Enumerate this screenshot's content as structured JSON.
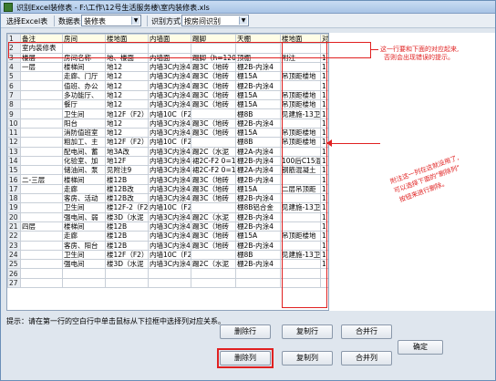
{
  "window": {
    "title": "识别Excel装修表 - F:\\工作\\12号生活服务楼\\室内装修表.xls"
  },
  "toolbar": {
    "select_sheet_label": "选择Excel表",
    "data_table_label": "数据表:",
    "data_table_value": "装修表",
    "identify_method_label": "识别方式:",
    "identify_method_value": "按房间识别"
  },
  "grid": {
    "rows": [
      {
        "n": "1",
        "cells": [
          "备注",
          "房间",
          "楼地面",
          "内墙面",
          "踢脚",
          "天棚",
          "楼地面",
          "对应楼层"
        ]
      },
      {
        "n": "2",
        "cells": [
          "室内装修表",
          "",
          "",
          "",
          "",
          "",
          "",
          ""
        ]
      },
      {
        "n": "3",
        "cells": [
          "楼层",
          "房间名称",
          "地、楼面",
          "内墙面",
          "踢脚（h=120",
          "顶棚",
          "附注",
          "1"
        ]
      },
      {
        "n": "4",
        "cells": [
          "一层",
          "楼梯间",
          "地12",
          "内墙3C内涂4",
          "踢3C（地砖",
          "棚2B-内涂4",
          "",
          "1"
        ]
      },
      {
        "n": "5",
        "cells": [
          "",
          "走廊、门厅",
          "地12",
          "内墙3C内涂4",
          "踢3C（地砖",
          "棚15A",
          "吊顶距楼地",
          "1"
        ]
      },
      {
        "n": "6",
        "cells": [
          "",
          "值班、办公",
          "地12",
          "内墙3C内涂4",
          "踢3C（地砖",
          "棚2B-内涂4",
          "",
          "1"
        ]
      },
      {
        "n": "7",
        "cells": [
          "",
          "多功能厅、",
          "地12",
          "内墙3C内涂4",
          "踢3C（地砖",
          "棚15A",
          "吊顶距楼地",
          "1"
        ]
      },
      {
        "n": "8",
        "cells": [
          "",
          "餐厅",
          "地12",
          "内墙3C内涂4",
          "踢3C（地砖",
          "棚15A",
          "吊顶距楼地",
          "1"
        ]
      },
      {
        "n": "9",
        "cells": [
          "",
          "卫生间",
          "地12F（F2）",
          "内墙10C（F2",
          "",
          "棚8B",
          "见建施-13卫",
          "1"
        ]
      },
      {
        "n": "10",
        "cells": [
          "",
          "阳台",
          "地12",
          "内墙3C内涂4",
          "踢3C（地砖",
          "棚2B-内涂4",
          "",
          "1"
        ]
      },
      {
        "n": "11",
        "cells": [
          "",
          "消防值班室",
          "地12",
          "内墙3C内涂4",
          "踢3C（地砖",
          "棚15A",
          "吊顶距楼地",
          "1"
        ]
      },
      {
        "n": "12",
        "cells": [
          "",
          "粗加工、主",
          "地12F（F2）",
          "内墙10C（F2",
          "",
          "棚8B",
          "吊顶距楼地",
          "1"
        ]
      },
      {
        "n": "13",
        "cells": [
          "",
          "配电间、蓄",
          "地3A改",
          "内墙3C内涂4",
          "踢2C（水泥",
          "棚2A-内涂4",
          "",
          "1"
        ]
      },
      {
        "n": "14",
        "cells": [
          "",
          "化验室、加",
          "地12F",
          "内墙3C内涂4",
          "裙2C-F2 0=1",
          "棚2B-内涂4",
          "100后C15混",
          "1"
        ]
      },
      {
        "n": "15",
        "cells": [
          "",
          "储油间、泵",
          "见附注9",
          "内墙3C内涂4",
          "裙2C-F2 0=1",
          "棚2A-内涂4",
          "钢筋混凝土",
          "1"
        ]
      },
      {
        "n": "16",
        "cells": [
          "二-三层",
          "楼梯间",
          "楼12B",
          "内墙3C内涂4",
          "踢3C（地砖",
          "棚2B-内涂4",
          "",
          "1"
        ]
      },
      {
        "n": "17",
        "cells": [
          "",
          "走廊",
          "楼12B改",
          "内墙3C内涂4",
          "踢3C（地砖",
          "棚15A",
          "二层吊顶距",
          "1"
        ]
      },
      {
        "n": "18",
        "cells": [
          "",
          "客房、活动",
          "楼12B改",
          "内墙3C内涂4",
          "踢3C（地砖",
          "棚2B-内涂4",
          "",
          "1"
        ]
      },
      {
        "n": "19",
        "cells": [
          "",
          "卫生间",
          "楼12F-2（F2）",
          "内墙10C（F2",
          "",
          "棚8B铝合金",
          "见建施-13卫",
          "1"
        ]
      },
      {
        "n": "20",
        "cells": [
          "",
          "强电间、弱",
          "楼3D（水泥",
          "内墙3C内涂4",
          "踢2C（水泥",
          "棚2B-内涂4",
          "",
          "1"
        ]
      },
      {
        "n": "21",
        "cells": [
          "四层",
          "楼梯间",
          "楼12B",
          "内墙3C内涂4",
          "踢3C（地砖",
          "棚2B-内涂4",
          "",
          "1"
        ]
      },
      {
        "n": "22",
        "cells": [
          "",
          "走廊",
          "楼12B",
          "内墙3C内涂4",
          "踢3C（地砖",
          "棚15A",
          "吊顶距楼地",
          "1"
        ]
      },
      {
        "n": "23",
        "cells": [
          "",
          "客房、阳台",
          "楼12B",
          "内墙3C内涂4",
          "踢3C（地砖",
          "棚2B-内涂4",
          "",
          "1"
        ]
      },
      {
        "n": "24",
        "cells": [
          "",
          "卫生间",
          "楼12F（F2）",
          "内墙10C（F2",
          "",
          "棚8B",
          "见建施-13卫",
          "1"
        ]
      },
      {
        "n": "25",
        "cells": [
          "",
          "强电间",
          "楼3D（水泥",
          "内墙3C内涂4",
          "踢2C（水泥",
          "棚2B-内涂4",
          "",
          "1"
        ]
      },
      {
        "n": "26",
        "cells": [
          "",
          "",
          "",
          "",
          "",
          "",
          "",
          ""
        ]
      },
      {
        "n": "27",
        "cells": [
          "",
          "",
          "",
          "",
          "",
          "",
          "",
          ""
        ]
      }
    ]
  },
  "annotations": {
    "note_top_line1": "这一行要和下面的对应起来,",
    "note_top_line2": "否则会出现错误的提示。",
    "note_mid_line1": "附注这一列在这就没用了,",
    "note_mid_line2": "可以选择下面的\"删除列\"",
    "note_mid_line3": "按钮来进行删除。",
    "red_color": "#e02020"
  },
  "footer": {
    "hint": "提示：请在第一行的空白行中单击鼠标从下拉框中选择列对应关系。",
    "buttons": {
      "delete_row": "删除行",
      "copy_row": "复制行",
      "merge_row": "合并行",
      "delete_col": "删除列",
      "copy_col": "复制列",
      "merge_col": "合并列",
      "confirm": "确定"
    }
  }
}
